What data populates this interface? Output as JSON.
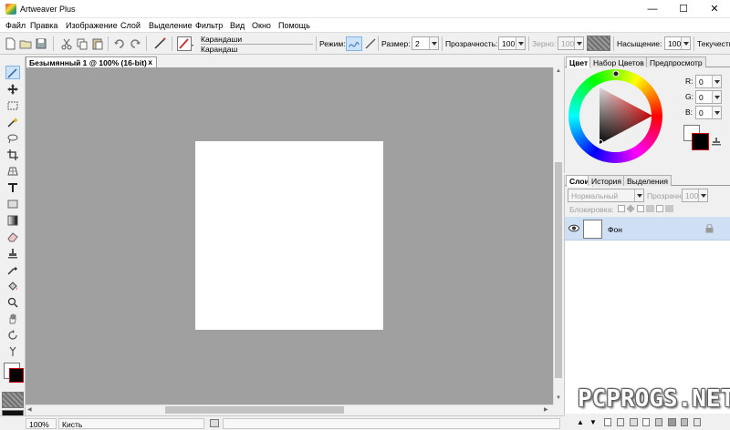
{
  "window": {
    "title": "Artweaver Plus",
    "minimize": "—",
    "maximize": "☐",
    "close": "✕"
  },
  "menu": [
    "Файл",
    "Правка",
    "Изображение",
    "Слой",
    "Выделение",
    "Фильтр",
    "Вид",
    "Окно",
    "Помощь"
  ],
  "toolbar": {
    "preset_name": "Карандаши",
    "preset_sub": "Карандаш",
    "mode_label": "Режим:",
    "size_label": "Размер:",
    "size_value": "2",
    "opacity_label": "Прозрачность:",
    "opacity_value": "100",
    "grain_label": "Зерно:",
    "grain_value": "100",
    "saturation_label": "Насыщение:",
    "saturation_value": "100",
    "flow_label": "Текучесть"
  },
  "document": {
    "tab_title": "Безымянный 1 @ 100% (16-bit)",
    "tab_close": "x"
  },
  "status": {
    "zoom": "100%",
    "tool": "Кисть"
  },
  "color_panel": {
    "tabs": [
      "Цвет",
      "Набор Цветов",
      "Предпросмотр"
    ],
    "r_label": "R:",
    "r_value": "0",
    "g_label": "G:",
    "g_value": "0",
    "b_label": "B:",
    "b_value": "0",
    "foreground": "#000000",
    "background": "#ffffff"
  },
  "layers_panel": {
    "tabs": [
      "Слои",
      "История",
      "Выделения"
    ],
    "blend_mode": "Нормальный",
    "opacity_label": "Прозрачн:",
    "opacity_value": "100",
    "lock_label": "Блокировка:",
    "layer_name": "Фон"
  },
  "watermark": "PCPROGS.NET",
  "colors": {
    "accent": "#cfe0f5",
    "workspace": "#a0a0a0"
  }
}
